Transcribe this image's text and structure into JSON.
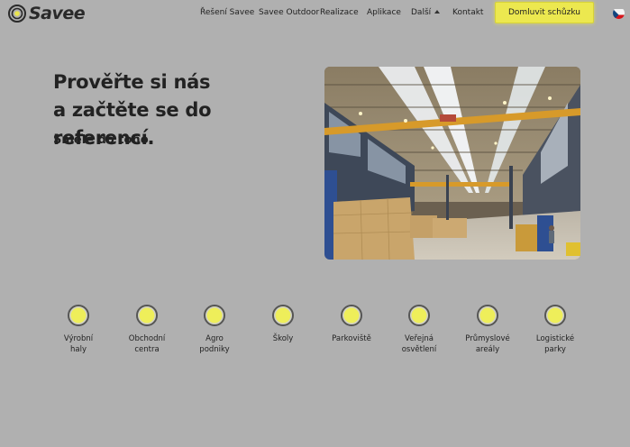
{
  "brand": {
    "name": "Savee"
  },
  "nav": {
    "links": [
      "Řešení Savee",
      "Savee Outdoor",
      "Realizace",
      "Aplikace",
      "Další",
      "Kontakt"
    ],
    "cta_label": "Domluvit schůzku",
    "language_flag": "czech-flag-icon"
  },
  "hero": {
    "title_line1": "Prověřte si nás",
    "title_line2": "a začtěte se do referencí.",
    "subtitle": "Směle do toho.",
    "image": "industrial-hall-photo"
  },
  "categories": [
    {
      "line1": "Výrobní",
      "line2": "haly"
    },
    {
      "line1": "Obchodní",
      "line2": "centra"
    },
    {
      "line1": "Agro",
      "line2": "podniky"
    },
    {
      "line1": "Školy",
      "line2": ""
    },
    {
      "line1": "Parkoviště",
      "line2": ""
    },
    {
      "line1": "Veřejná",
      "line2": "osvětlení"
    },
    {
      "line1": "Průmyslové",
      "line2": "areály"
    },
    {
      "line1": "Logistické",
      "line2": "parky"
    }
  ],
  "colors": {
    "background": "#b0b0b0",
    "accent_yellow": "#ece84f",
    "text": "#222222"
  }
}
